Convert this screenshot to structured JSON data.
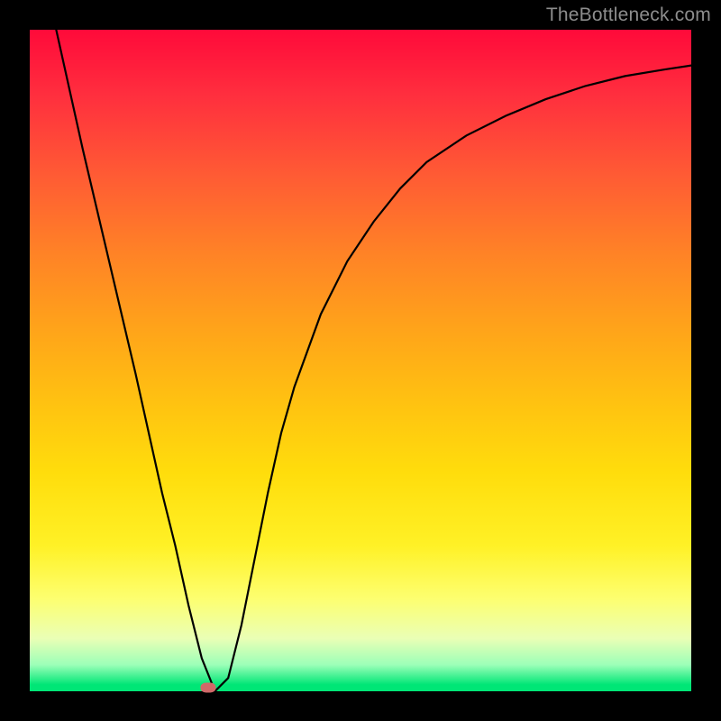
{
  "watermark": "TheBottleneck.com",
  "chart_data": {
    "type": "line",
    "title": "",
    "xlabel": "",
    "ylabel": "",
    "xlim": [
      0,
      100
    ],
    "ylim": [
      0,
      100
    ],
    "grid": false,
    "series": [
      {
        "name": "bottleneck-curve",
        "x": [
          4,
          8,
          12,
          16,
          20,
          22,
          24,
          26,
          28,
          30,
          32,
          34,
          36,
          38,
          40,
          44,
          48,
          52,
          56,
          60,
          66,
          72,
          78,
          84,
          90,
          96,
          100
        ],
        "values": [
          100,
          82,
          65,
          48,
          30,
          22,
          13,
          5,
          0,
          2,
          10,
          20,
          30,
          39,
          46,
          57,
          65,
          71,
          76,
          80,
          84,
          87,
          89.5,
          91.5,
          93,
          94,
          94.6
        ]
      }
    ],
    "annotations": [
      {
        "name": "min-marker",
        "x": 27,
        "y": 0.6
      }
    ],
    "background_gradient": [
      "#ff0a3a",
      "#ffdd0c",
      "#00e676"
    ]
  }
}
